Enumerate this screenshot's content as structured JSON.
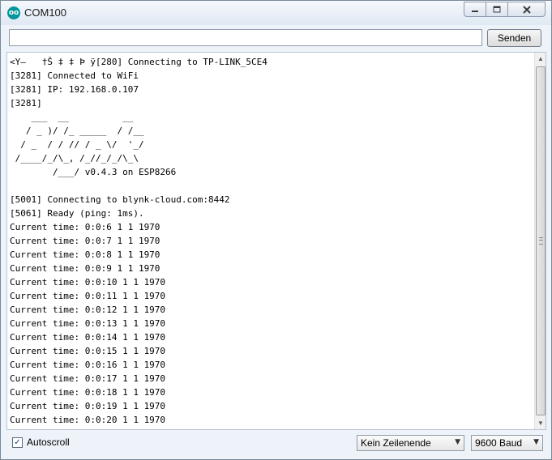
{
  "window": {
    "title": "COM100",
    "icon_label": "oo",
    "controls": {
      "minimize": "minimize-icon",
      "maximize": "maximize-icon",
      "close": "close-icon"
    }
  },
  "send": {
    "input_value": "",
    "button_label": "Senden"
  },
  "output": {
    "lines": [
      "<Y—   †Š ‡ ‡ Þ ÿ[280] Connecting to TP-LINK_5CE4",
      "[3281] Connected to WiFi",
      "[3281] IP: 192.168.0.107",
      "[3281]",
      "    ___  __          __",
      "   / _ )/ /_ _____  / /__",
      "  / _  / / // / _ \\/  '_/",
      " /____/_/\\_, /_//_/_/\\_\\",
      "        /___/ v0.4.3 on ESP8266",
      "",
      "[5001] Connecting to blynk-cloud.com:8442",
      "[5061] Ready (ping: 1ms).",
      "Current time: 0:0:6 1 1 1970",
      "Current time: 0:0:7 1 1 1970",
      "Current time: 0:0:8 1 1 1970",
      "Current time: 0:0:9 1 1 1970",
      "Current time: 0:0:10 1 1 1970",
      "Current time: 0:0:11 1 1 1970",
      "Current time: 0:0:12 1 1 1970",
      "Current time: 0:0:13 1 1 1970",
      "Current time: 0:0:14 1 1 1970",
      "Current time: 0:0:15 1 1 1970",
      "Current time: 0:0:16 1 1 1970",
      "Current time: 0:0:17 1 1 1970",
      "Current time: 0:0:18 1 1 1970",
      "Current time: 0:0:19 1 1 1970",
      "Current time: 0:0:20 1 1 1970"
    ]
  },
  "status": {
    "autoscroll_label": "Autoscroll",
    "autoscroll_checked": true,
    "line_ending": "Kein Zeilenende",
    "baud": "9600 Baud"
  },
  "colors": {
    "app_icon": "#00979c",
    "window_bg": "#eef3fa",
    "close_hover": "#c75050"
  }
}
